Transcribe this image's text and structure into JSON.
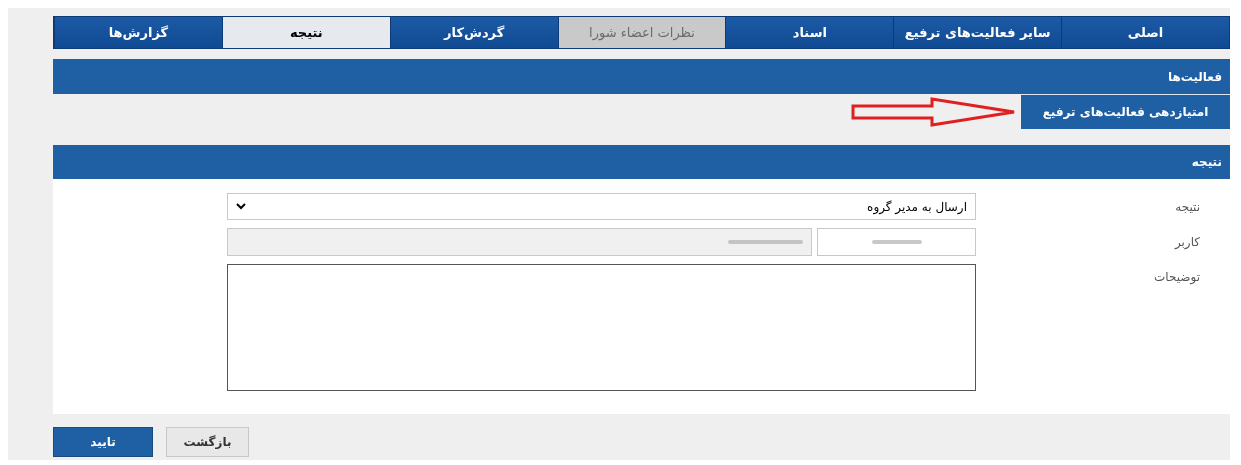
{
  "tabs": [
    {
      "label": "اصلی",
      "kind": "normal",
      "selected": false
    },
    {
      "label": "سایر فعالیت‌های ترفیع",
      "kind": "normal",
      "selected": false
    },
    {
      "label": "اسناد",
      "kind": "normal",
      "selected": false
    },
    {
      "label": "نظرات اعضاء شورا",
      "kind": "disabled",
      "selected": false
    },
    {
      "label": "گردش‌کار",
      "kind": "normal",
      "selected": false
    },
    {
      "label": "نتیجه",
      "kind": "normal",
      "selected": true
    },
    {
      "label": "گزارش‌ها",
      "kind": "normal",
      "selected": false
    }
  ],
  "activities": {
    "title": "فعالیت‌ها",
    "items": [
      "امتیازدهی فعالیت‌های ترفیع"
    ]
  },
  "result": {
    "title": "نتیجه",
    "result_label": "نتیجه",
    "result_value": "ارسال به مدیر گروه",
    "user_label": "کاربر",
    "notes_label": "توضیحات"
  },
  "buttons": [
    {
      "label": "بازگشت",
      "kind": "secondary"
    },
    {
      "label": "تایید",
      "kind": "primary"
    }
  ]
}
